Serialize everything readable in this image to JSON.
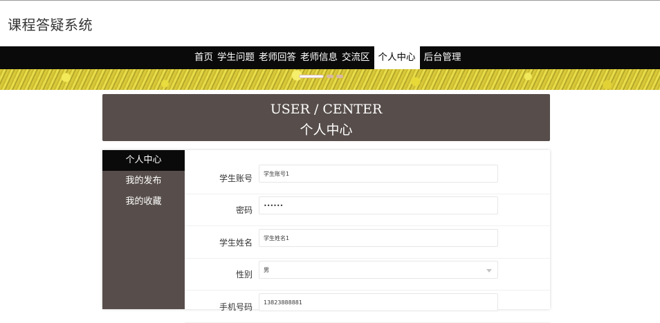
{
  "site": {
    "title": "课程答疑系统"
  },
  "nav": {
    "items": [
      {
        "label": "首页",
        "active": false
      },
      {
        "label": "学生问题",
        "active": false
      },
      {
        "label": "老师回答",
        "active": false
      },
      {
        "label": "老师信息",
        "active": false
      },
      {
        "label": "交流区",
        "active": false
      },
      {
        "label": "个人中心",
        "active": true
      },
      {
        "label": "后台管理",
        "active": false
      }
    ]
  },
  "carousel": {
    "slide_count": 3,
    "active_index": 0
  },
  "header": {
    "title_en": "USER / CENTER",
    "title_cn": "个人中心"
  },
  "sidebar": {
    "items": [
      {
        "label": "个人中心",
        "active": true
      },
      {
        "label": "我的发布",
        "active": false
      },
      {
        "label": "我的收藏",
        "active": false
      }
    ]
  },
  "form": {
    "fields": [
      {
        "label": "学生账号",
        "value": "学生账号1",
        "type": "text"
      },
      {
        "label": "密码",
        "value": "••••••",
        "type": "password"
      },
      {
        "label": "学生姓名",
        "value": "学生姓名1",
        "type": "text"
      },
      {
        "label": "性别",
        "value": "男",
        "type": "select"
      },
      {
        "label": "手机号码",
        "value": "13823888881",
        "type": "text"
      }
    ]
  },
  "colors": {
    "nav_bg": "#0a0a0a",
    "panel_bg": "#574e4b",
    "active_sidebar_bg": "#0a0a0a",
    "text": "#333333"
  }
}
